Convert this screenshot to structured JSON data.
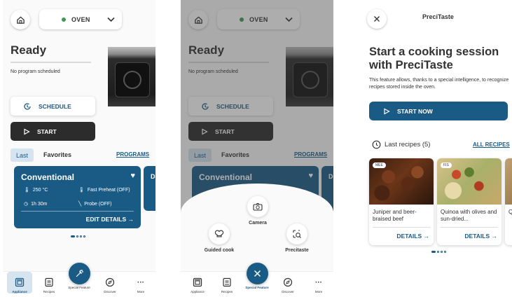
{
  "screen1": {
    "oven_label": "OVEN",
    "status_title": "Ready",
    "status_subtitle": "No program scheduled",
    "schedule_label": "SCHEDULE",
    "start_label": "START",
    "tabs": {
      "last": "Last",
      "favorites": "Favorites",
      "programs": "PROGRAMS"
    },
    "card": {
      "title": "Conventional",
      "temperature": "250 °C",
      "preheat": "Fast Preheat (OFF)",
      "duration": "1h 30m",
      "probe": "Probe (OFF)",
      "edit": "EDIT DETAILS",
      "next_card_initial": "D"
    },
    "colors": {
      "accent": "#1a5b86",
      "status_dot": "#3c9a52",
      "dark_button": "#2c2c2c"
    }
  },
  "navbar": {
    "items": [
      {
        "label": "Appliance",
        "icon": "appliance-icon"
      },
      {
        "label": "Recipes",
        "icon": "recipes-icon"
      },
      {
        "label": "Special Feature",
        "icon": "sparkle-icon"
      },
      {
        "label": "Discover",
        "icon": "compass-icon"
      },
      {
        "label": "More",
        "icon": "more-icon"
      }
    ]
  },
  "screen2": {
    "oven_label": "OVEN",
    "status_title": "Ready",
    "status_subtitle": "No program scheduled",
    "schedule_label": "SCHEDULE",
    "start_label": "START",
    "tabs": {
      "last": "Last",
      "favorites": "Favorites",
      "programs": "PROGRAMS"
    },
    "card_title": "Conventional",
    "card2_initial": "D",
    "sheet": {
      "camera": "Camera",
      "guided": "Guided cook",
      "precitaste": "Precitaste"
    }
  },
  "screen3": {
    "header_title": "PreciTaste",
    "headline": "Start a cooking session with PreciTaste",
    "description": "This feature allows, thanks to a special intelligence, to recognize recipes stored inside the oven.",
    "start_now": "START NOW",
    "last_recipes": "Last recipes (5)",
    "all_recipes": "ALL RECIPES",
    "recipes": [
      {
        "badge": "MEE",
        "name": "Juniper and beer-braised beef",
        "details": "DETAILS"
      },
      {
        "badge": "FIS",
        "name": "Quinoa with olives and sun-dried...",
        "details": "DETAILS"
      },
      {
        "badge": "",
        "name": "Q a",
        "details": ""
      }
    ]
  }
}
